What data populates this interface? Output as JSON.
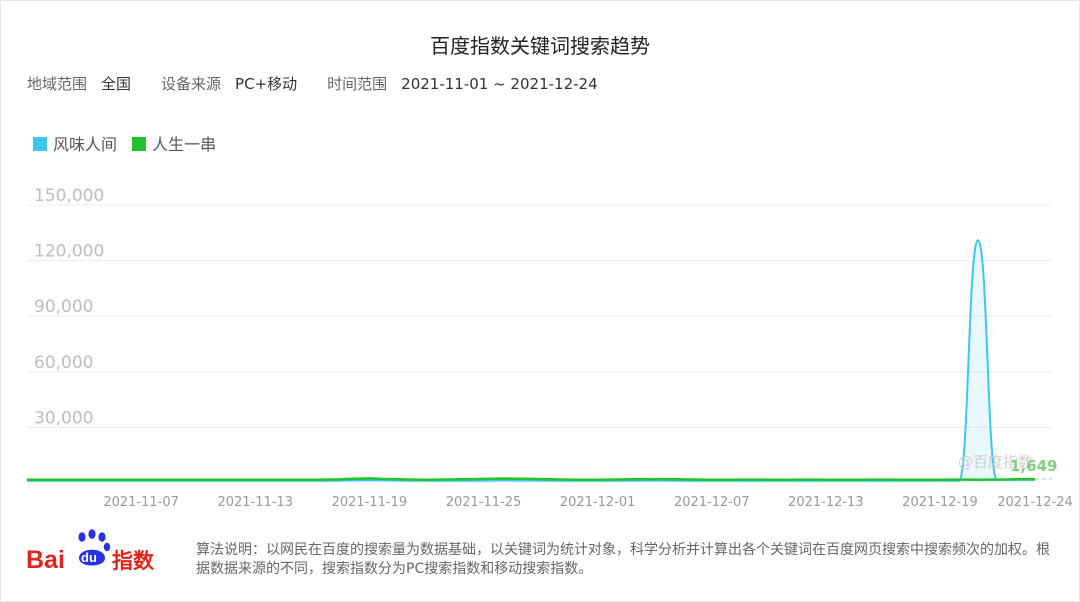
{
  "page": {
    "title": "百度指数关键词搜索趋势",
    "filters": {
      "region_label": "地域范围",
      "region_value": "全国",
      "device_label": "设备来源",
      "device_value": "PC+移动",
      "time_label": "时间范围",
      "time_value": "2021-11-01 ~ 2021-12-24"
    },
    "watermark": "@百度指数",
    "end_value_label": "1,649",
    "footer": {
      "logo_text": "Bai du 指数",
      "note": "算法说明：以网民在百度的搜索量为数据基础，以关键词为统计对象，科学分析并计算出各个关键词在百度网页搜索中搜索频次的加权。根据数据来源的不同，搜索指数分为PC搜索指数和移动搜索指数。"
    }
  },
  "colors": {
    "series1": "#3ec6f0",
    "series2": "#22c32e",
    "grid": "#ececec",
    "axis_text": "#999999",
    "brand_red": "#e1251b",
    "brand_blue": "#2932e1"
  },
  "chart_data": {
    "type": "line",
    "x_start": "2021-11-01",
    "x_end": "2021-12-24",
    "x_ticks": [
      "2021-11-07",
      "2021-11-13",
      "2021-11-19",
      "2021-11-25",
      "2021-12-01",
      "2021-12-07",
      "2021-12-13",
      "2021-12-19",
      "2021-12-24"
    ],
    "y_ticks": [
      "150,000",
      "120,000",
      "90,000",
      "60,000",
      "30,000"
    ],
    "ylim": [
      0,
      150000
    ],
    "series": [
      {
        "name": "风味人间",
        "color": "#3ec6f0",
        "values": [
          1200,
          1200,
          1250,
          1200,
          1200,
          1250,
          1200,
          1200,
          1200,
          1200,
          1250,
          1200,
          1200,
          1200,
          1250,
          1200,
          1300,
          1400,
          1500,
          1400,
          1300,
          1250,
          1200,
          1250,
          1300,
          1400,
          1350,
          1300,
          1250,
          1200,
          1200,
          1250,
          1300,
          1350,
          1300,
          1250,
          1200,
          1200,
          1250,
          1200,
          1200,
          1250,
          1200,
          1200,
          1200,
          1250,
          1200,
          1200,
          1300,
          1200,
          131000,
          1800,
          1649,
          1649
        ]
      },
      {
        "name": "人生一串",
        "color": "#22c32e",
        "values": [
          1700,
          1700,
          1750,
          1700,
          1700,
          1700,
          1750,
          1700,
          1700,
          1700,
          1750,
          1700,
          1700,
          1700,
          1750,
          1700,
          1900,
          2200,
          2500,
          2100,
          1900,
          1800,
          1900,
          2000,
          2200,
          2400,
          2300,
          2100,
          1900,
          1800,
          1800,
          1900,
          2000,
          2100,
          2000,
          1900,
          1800,
          1800,
          1850,
          1800,
          1800,
          1850,
          1800,
          1800,
          1800,
          1850,
          1800,
          1800,
          1800,
          1850,
          1800,
          1850,
          2000,
          2100
        ]
      }
    ]
  }
}
